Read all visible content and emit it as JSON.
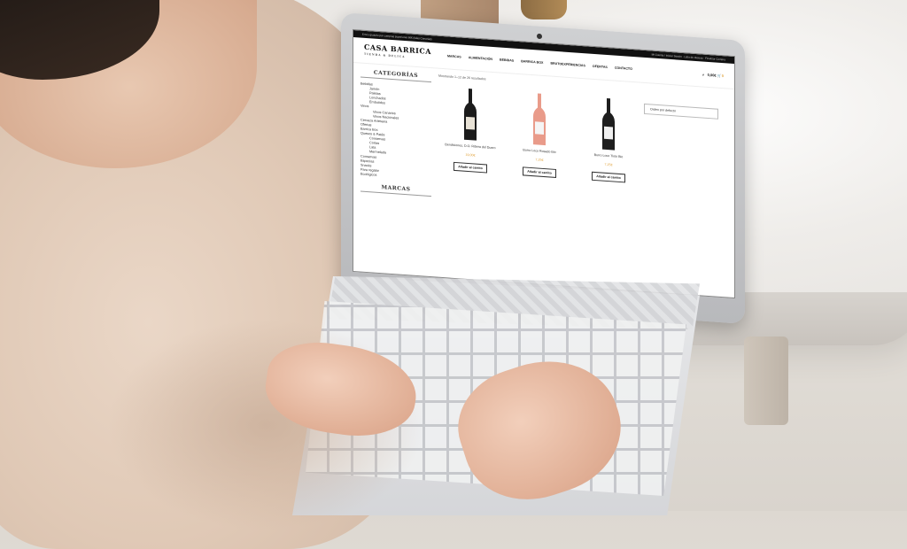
{
  "scene": {
    "description_colors": {
      "wall": "#ddd8d1",
      "marble": "#f0eeeb",
      "skin": "#e3b39a",
      "sweater": "#e0c9b6",
      "laptop": "#cfd0d2"
    }
  },
  "screen": {
    "topbar_left": "Envío gratuito por compras superiores 60€ (Islas Canarias)",
    "topbar_links": [
      "Mi Cuenta / Iniciar Sesión",
      "Lista de deseos",
      "Finalizar Compra"
    ],
    "logo_title": "CASA BARRICA",
    "logo_subtitle": "TIENDA & DELICA",
    "nav": [
      "MARCAS",
      "ALIMENTACIÓN",
      "BEBIDAS",
      "BARRICA BOX",
      "BRUTOEXPERIENCIAS",
      "OFERTAS",
      "CONTACTO"
    ],
    "cart_total": "0,00€",
    "cart_count": "0",
    "sidebar_title": "CATEGORÍAS",
    "categories": [
      {
        "label": "Bebidas",
        "level": 0
      },
      {
        "label": "Jamón",
        "level": 1
      },
      {
        "label": "Paletas",
        "level": 1
      },
      {
        "label": "Lonchados",
        "level": 1
      },
      {
        "label": "Embutidos",
        "level": 1
      },
      {
        "label": "Vinos",
        "level": 0
      },
      {
        "label": "Vinos Canarios",
        "level": 2
      },
      {
        "label": "Vinos Nacionales",
        "level": 2
      },
      {
        "label": "Cerveza Artesana",
        "level": 0
      },
      {
        "label": "Ofertas",
        "level": 0
      },
      {
        "label": "Barrica Box",
        "level": 0
      },
      {
        "label": "Quesos & Patés",
        "level": 0
      },
      {
        "label": "Conservas",
        "level": 1
      },
      {
        "label": "Cortas",
        "level": 1
      },
      {
        "label": "Lata",
        "level": 1
      },
      {
        "label": "Mermelada",
        "level": 1
      },
      {
        "label": "Conservas",
        "level": 0
      },
      {
        "label": "Especias",
        "level": 0
      },
      {
        "label": "Snacks",
        "level": 0
      },
      {
        "label": "Para regalar",
        "level": 0
      },
      {
        "label": "Ecológicos",
        "level": 0
      }
    ],
    "brands_title": "MARCAS",
    "results_text": "Mostrando 1–12 de 26 resultados",
    "sort_label": "Orden por defecto",
    "products": [
      {
        "name": "Bendiciones, D.O. Ribera del Duero",
        "price": "19,00€",
        "button": "Añadir al carrito",
        "bottle_color": "#1b1b1b",
        "label_color": "#e8e2d6"
      },
      {
        "name": "Burro Loco Rosado Bio",
        "price": "7,25€",
        "button": "Añadir al carrito",
        "bottle_color": "#e99b8a",
        "label_color": "#f5f5f5"
      },
      {
        "name": "Burro Loco Tinto Bio",
        "price": "7,25€",
        "button": "Añadir al carrito",
        "bottle_color": "#1e1e1e",
        "label_color": "#efefef"
      }
    ]
  }
}
